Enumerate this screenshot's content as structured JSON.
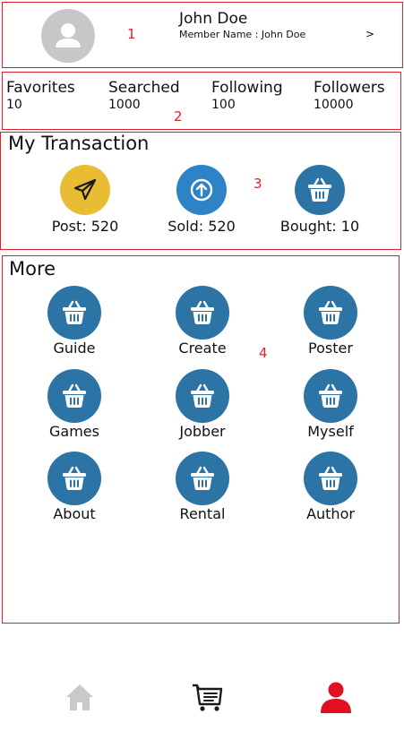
{
  "profile": {
    "name": "John Doe",
    "member_line": "Member Name : John Doe",
    "chevron": ">",
    "section_marker": "1"
  },
  "stats": {
    "section_marker": "2",
    "items": [
      {
        "label": "Favorites",
        "value": "10"
      },
      {
        "label": "Searched",
        "value": "1000"
      },
      {
        "label": "Following",
        "value": "100"
      },
      {
        "label": "Followers",
        "value": "10000"
      }
    ]
  },
  "transactions": {
    "title": "My Transaction",
    "section_marker": "3",
    "items": [
      {
        "label": "Post: 520",
        "icon": "paper-plane-icon",
        "color": "#e8bd33"
      },
      {
        "label": "Sold: 520",
        "icon": "arrow-up-circle-icon",
        "color": "#2e83c6"
      },
      {
        "label": "Bought: 10",
        "icon": "basket-icon",
        "color": "#2d74a6"
      }
    ]
  },
  "more": {
    "title": "More",
    "section_marker": "4",
    "items": [
      {
        "label": "Guide",
        "icon": "basket-icon"
      },
      {
        "label": "Create",
        "icon": "basket-icon"
      },
      {
        "label": "Poster",
        "icon": "basket-icon"
      },
      {
        "label": "Games",
        "icon": "basket-icon"
      },
      {
        "label": "Jobber",
        "icon": "basket-icon"
      },
      {
        "label": "Myself",
        "icon": "basket-icon"
      },
      {
        "label": "About",
        "icon": "basket-icon"
      },
      {
        "label": "Rental",
        "icon": "basket-icon"
      },
      {
        "label": "Author",
        "icon": "basket-icon"
      }
    ]
  },
  "bottom_nav": {
    "items": [
      {
        "icon": "home-icon",
        "active": false
      },
      {
        "icon": "cart-icon",
        "active": false
      },
      {
        "icon": "person-icon",
        "active": true
      }
    ],
    "colors": {
      "inactive": "#c9c9c9",
      "cart": "#1a1a1a",
      "active": "#e0101e"
    }
  },
  "colors": {
    "section_border": "#e0202a",
    "accent_blue": "#2d74a6",
    "accent_gold": "#e8bd33"
  }
}
